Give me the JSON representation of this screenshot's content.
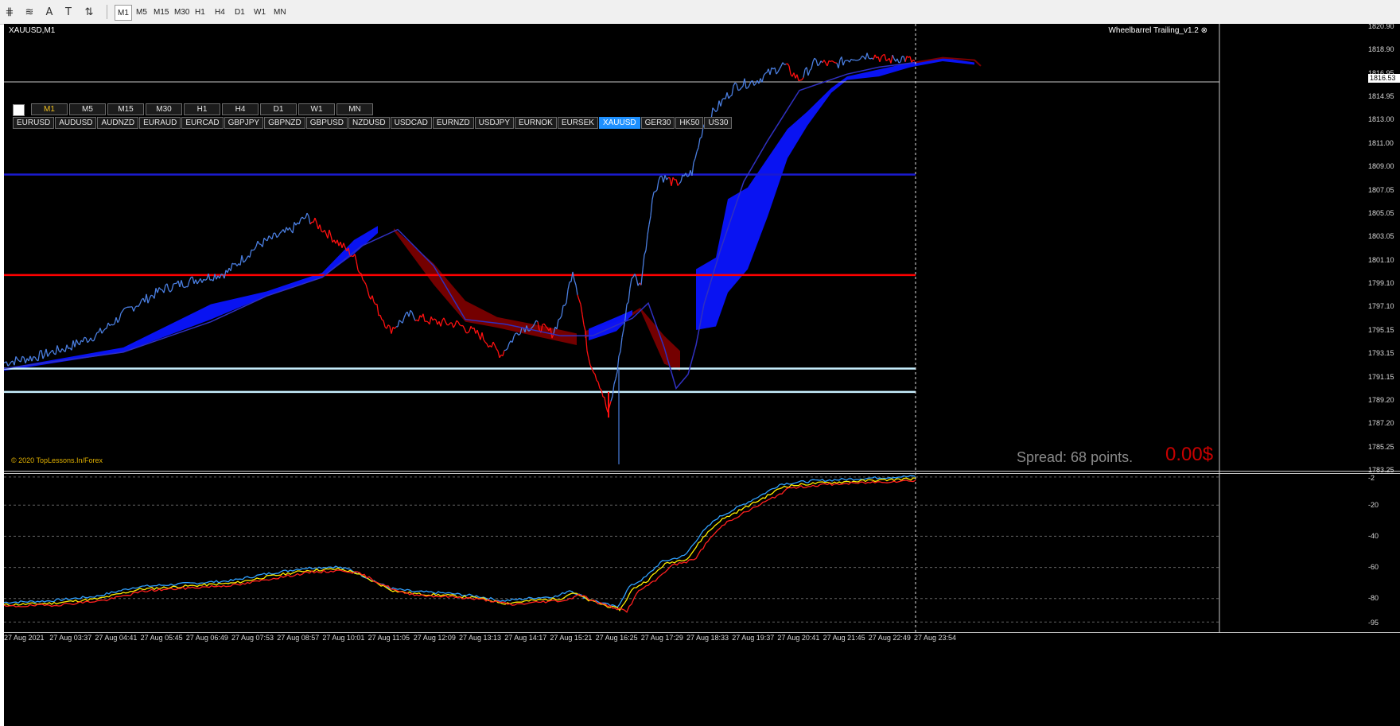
{
  "toolbar": {
    "tools": [
      {
        "icon": "crosshair-icon",
        "glyph": "⋕"
      },
      {
        "icon": "fibonacci-icon",
        "glyph": "≋"
      },
      {
        "icon": "text-icon",
        "glyph": "A"
      },
      {
        "icon": "text-label-icon",
        "glyph": "T"
      },
      {
        "icon": "arrows-icon",
        "glyph": "⇅"
      }
    ],
    "timeframes": [
      "M1",
      "M5",
      "M15",
      "M30",
      "H1",
      "H4",
      "D1",
      "W1",
      "MN"
    ],
    "active_timeframe": "M1"
  },
  "chart": {
    "symbol_title": "XAUUSD,M1",
    "indicator_name": "Wheelbarrel Trailing_v1.2 ⊗",
    "copyright": "© 2020 TopLessons.In/Forex",
    "spread_text": "Spread: 68 points.",
    "profit_text": "0.00$",
    "panel_timeframes": [
      "M1",
      "M5",
      "M15",
      "M30",
      "H1",
      "H4",
      "D1",
      "W1",
      "MN"
    ],
    "panel_active_timeframe": "M1",
    "panel_symbols": [
      "EURUSD",
      "AUDUSD",
      "AUDNZD",
      "EURAUD",
      "EURCAD",
      "GBPJPY",
      "GBPNZD",
      "GBPUSD",
      "NZDUSD",
      "USDCAD",
      "EURNZD",
      "USDJPY",
      "EURNOK",
      "EURSEK",
      "XAUUSD",
      "GER30",
      "HK50",
      "US30"
    ],
    "panel_active_symbol": "XAUUSD",
    "current_price": "1816.53",
    "price_axis": [
      "1820.90",
      "1818.90",
      "1816.95",
      "1814.95",
      "1813.00",
      "1811.00",
      "1809.00",
      "1807.05",
      "1805.05",
      "1803.05",
      "1801.10",
      "1799.10",
      "1797.10",
      "1795.15",
      "1793.15",
      "1791.15",
      "1789.20",
      "1787.20",
      "1785.25",
      "1783.25"
    ],
    "sub_axis": [
      "-2",
      "-20",
      "-40",
      "-60",
      "-80",
      "-95"
    ],
    "time_axis": [
      "27 Aug 2021",
      "27 Aug 03:37",
      "27 Aug 04:41",
      "27 Aug 05:45",
      "27 Aug 06:49",
      "27 Aug 07:53",
      "27 Aug 08:57",
      "27 Aug 10:01",
      "27 Aug 11:05",
      "27 Aug 12:09",
      "27 Aug 13:13",
      "27 Aug 14:17",
      "27 Aug 15:21",
      "27 Aug 16:25",
      "27 Aug 17:29",
      "27 Aug 18:33",
      "27 Aug 19:37",
      "27 Aug 20:41",
      "27 Aug 21:45",
      "27 Aug 22:49",
      "27 Aug 23:54"
    ],
    "horizontal_levels": [
      {
        "price": 1808.6,
        "color": "#1a1ad0"
      },
      {
        "price": 1800.0,
        "color": "#ff0000"
      },
      {
        "price": 1792.0,
        "color": "#c8f0ff"
      },
      {
        "price": 1790.0,
        "color": "#c8f0ff"
      }
    ],
    "colors": {
      "bull": "#4a7ee0",
      "bear": "#ff1010",
      "cloud_up": "#0a14ff",
      "cloud_down": "#7a0000",
      "kijun": "#3030c0",
      "osc_1": "#30a0ff",
      "osc_2": "#ffee00",
      "osc_3": "#ff2020"
    },
    "price_range": [
      1783.25,
      1821.5
    ],
    "osc_range": [
      -100,
      0
    ]
  }
}
